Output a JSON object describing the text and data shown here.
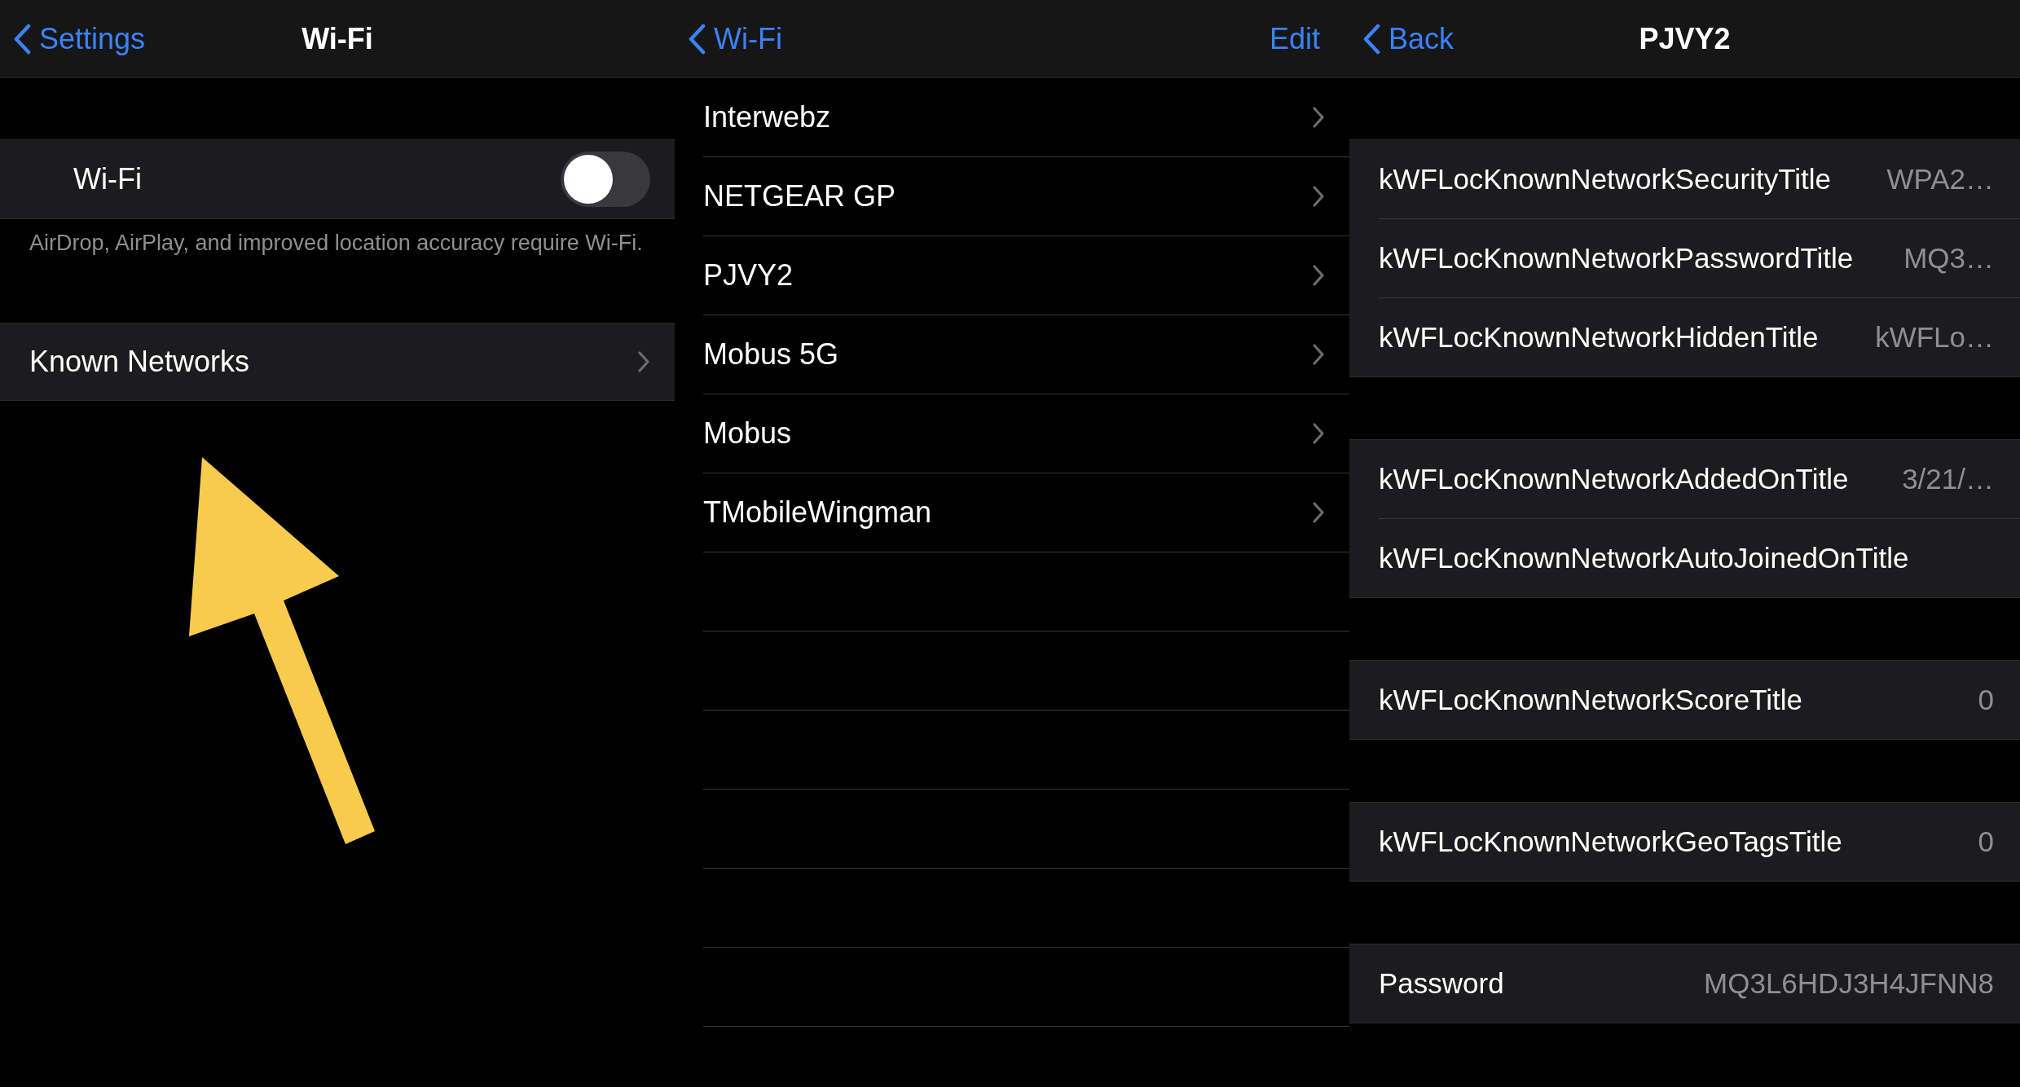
{
  "wifi_screen": {
    "nav": {
      "back": "Settings",
      "title": "Wi-Fi"
    },
    "wifi_toggle": {
      "label": "Wi-Fi",
      "on": false
    },
    "footer": "AirDrop, AirPlay, and improved location accuracy require Wi-Fi.",
    "known_networks": {
      "label": "Known Networks"
    }
  },
  "networks_screen": {
    "nav": {
      "back": "Wi-Fi",
      "action": "Edit"
    },
    "networks": [
      {
        "name": "Interwebz"
      },
      {
        "name": "NETGEAR GP"
      },
      {
        "name": "PJVY2"
      },
      {
        "name": "Mobus 5G"
      },
      {
        "name": "Mobus"
      },
      {
        "name": "TMobileWingman"
      }
    ]
  },
  "detail_screen": {
    "nav": {
      "back": "Back",
      "title": "PJVY2"
    },
    "groups": [
      {
        "rows": [
          {
            "label": "kWFLocKnownNetworkSecurityTitle",
            "value": "WPA2…"
          },
          {
            "label": "kWFLocKnownNetworkPasswordTitle",
            "value": "MQ3…"
          },
          {
            "label": "kWFLocKnownNetworkHiddenTitle",
            "value": "kWFLo…"
          }
        ]
      },
      {
        "rows": [
          {
            "label": "kWFLocKnownNetworkAddedOnTitle",
            "value": "3/21/…"
          },
          {
            "label": "kWFLocKnownNetworkAutoJoinedOnTitle"
          }
        ]
      },
      {
        "rows": [
          {
            "label": "kWFLocKnownNetworkScoreTitle",
            "value": "0"
          }
        ]
      },
      {
        "rows": [
          {
            "label": "kWFLocKnownNetworkGeoTagsTitle",
            "value": "0"
          }
        ]
      },
      {
        "rows": [
          {
            "label": "Password",
            "value": "MQ3L6HDJ3H4JFNN8"
          }
        ]
      }
    ]
  }
}
